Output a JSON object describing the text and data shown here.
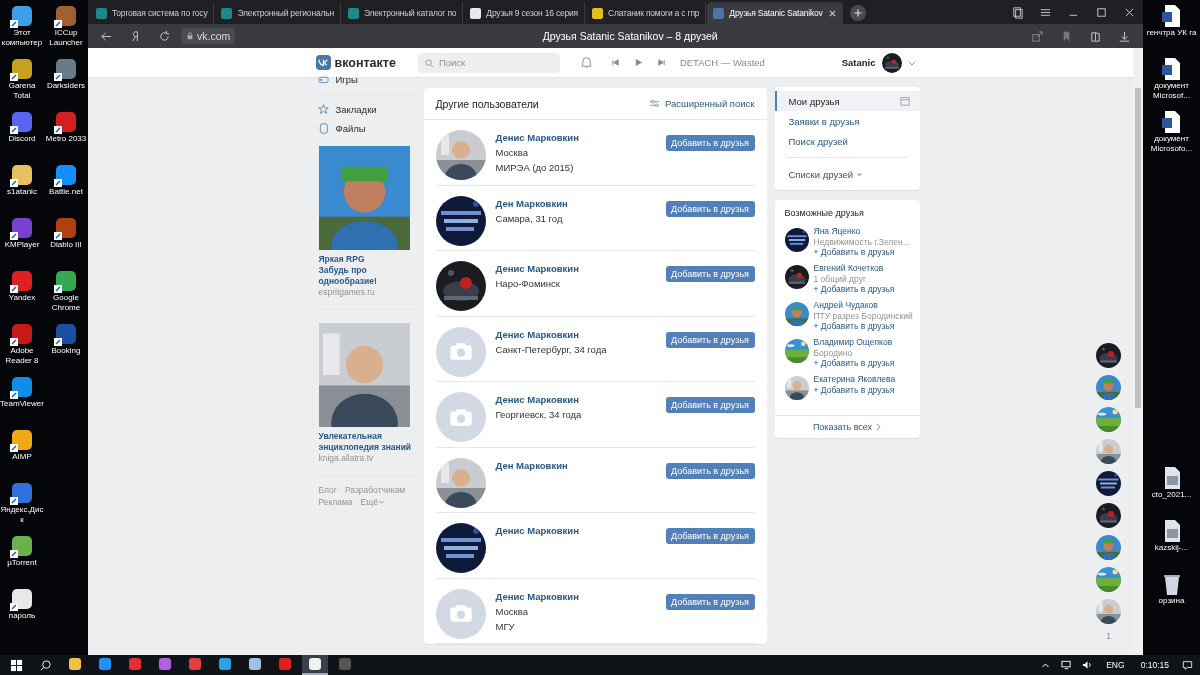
{
  "desktop_left": {
    "columns": [
      [
        {
          "label": "Этот компьютер",
          "color": "#3aa0e8"
        },
        {
          "label": "Garena Total",
          "color": "#c8a020"
        },
        {
          "label": "Discord",
          "color": "#5865f2"
        },
        {
          "label": "s1atanic",
          "color": "#e8c060"
        },
        {
          "label": "KMPlayer",
          "color": "#7a3fd0"
        },
        {
          "label": "Yandex",
          "color": "#e02020"
        },
        {
          "label": "Adobe Reader 8",
          "color": "#c81818"
        },
        {
          "label": "TeamViewer",
          "color": "#0e8ee9"
        },
        {
          "label": "AIMP",
          "color": "#f0a818"
        },
        {
          "label": "Яндекс.Диск",
          "color": "#3070e0"
        },
        {
          "label": "µTorrent",
          "color": "#6ab04c"
        },
        {
          "label": "пароль",
          "color": "#e8e8e8"
        }
      ],
      [
        {
          "label": "ICCup Launcher",
          "color": "#a06030"
        },
        {
          "label": "Darksiders",
          "color": "#6a7a8a"
        },
        {
          "label": "Metro 2033",
          "color": "#d02020"
        },
        {
          "label": "Battle.net",
          "color": "#148eff"
        },
        {
          "label": "Diablo III",
          "color": "#b04010"
        },
        {
          "label": "Google Chrome",
          "color": "#34a853"
        },
        {
          "label": "Booking",
          "color": "#1a4fa0"
        }
      ]
    ]
  },
  "browser": {
    "tabs": [
      {
        "title": "Торговая система по госу",
        "color": "#1a8a8a",
        "selected": false
      },
      {
        "title": "Электронный региональн",
        "color": "#1a8a8a",
        "selected": false
      },
      {
        "title": "Электронный каталог по",
        "color": "#1a8a8a",
        "selected": false
      },
      {
        "title": "Друзья 9 сезон 16 серия",
        "color": "#e8e8e8",
        "selected": false
      },
      {
        "title": "Слатаник помоги а с гпр",
        "color": "#e0c020",
        "selected": false
      },
      {
        "title": "Друзья Satanic Satanikov",
        "color": "#4a76a8",
        "selected": true
      }
    ],
    "address": "vk.com",
    "page_title": "Друзья Satanic Satanikov – 8 друзей"
  },
  "vk_header": {
    "logo": "вконтакте",
    "search_placeholder": "Поиск",
    "track": "DETACH — Wasted",
    "user": "Satanic"
  },
  "left_menu": {
    "items": [
      "Игры",
      "Закладки",
      "Файлы"
    ],
    "ads": [
      {
        "title": "Яркая RPG",
        "text": "Забудь про однообразие!",
        "domain": "espritgames.ru"
      },
      {
        "title": "Увлекательная энциклопедия знаний",
        "domain": "kniga.allatra.tv"
      }
    ],
    "footer": [
      "Блог",
      "Разработчикам",
      "Реклама",
      "Ещё"
    ]
  },
  "people": {
    "title": "Другие пользователи",
    "advanced_search": "Расширенный поиск",
    "rows": [
      {
        "name": "Денис Марковкин",
        "details": [
          "Москва",
          "МИРЭА (до 2015)"
        ],
        "kind": "picture",
        "button": "Добавить в друзья"
      },
      {
        "name": "Ден Марковкин",
        "details": [
          "Самара, 31 год"
        ],
        "kind": "picture",
        "button": "Добавить в друзья"
      },
      {
        "name": "Денис Марковкин",
        "details": [
          "Наро-Фоминск"
        ],
        "kind": "picture",
        "button": "Добавить в друзья"
      },
      {
        "name": "Денис Марковкин",
        "details": [
          "Санкт-Петербург, 34 года"
        ],
        "kind": "placeholder",
        "button": "Добавить в друзья"
      },
      {
        "name": "Денис Марковкин",
        "details": [
          "Георгиевск, 34 года"
        ],
        "kind": "placeholder",
        "button": "Добавить в друзья"
      },
      {
        "name": "Ден Марковкин",
        "details": [],
        "kind": "picture",
        "button": "Добавить в друзья"
      },
      {
        "name": "Денис Марковкин",
        "details": [],
        "kind": "picture",
        "button": "Добавить в друзья"
      },
      {
        "name": "Денис Марковкин",
        "details": [
          "Москва",
          "МГУ"
        ],
        "kind": "placeholder",
        "button": "Добавить в друзья"
      }
    ]
  },
  "friends_menu": {
    "items": [
      {
        "label": "Мои друзья",
        "selected": true
      },
      {
        "label": "Заявки в друзья",
        "selected": false
      },
      {
        "label": "Поиск друзей",
        "selected": false
      }
    ],
    "lists": "Списки друзей"
  },
  "possible_friends": {
    "title": "Возможные друзья",
    "show_all": "Показать всех",
    "items": [
      {
        "name": "Яна Яценко",
        "info": "Недвижимость г.Зелен...",
        "add": "+ Добавить в друзья"
      },
      {
        "name": "Евгений Кочетков",
        "info": "1 общий друг",
        "add": "+ Добавить в друзья"
      },
      {
        "name": "Андрей Чудаков",
        "info": "ПТУ разрез Бородинский",
        "add": "+ Добавить в друзья"
      },
      {
        "name": "Владимир Ощепков",
        "info": "Бородино",
        "add": "+ Добавить в друзья"
      },
      {
        "name": "Екатерина Яковлева",
        "add": "+ Добавить в друзья"
      }
    ]
  },
  "chats": {
    "count": "1"
  },
  "desktop_right": {
    "top": [
      "генчтра УК га",
      "документ Microsof...",
      "документ Microsofo..."
    ],
    "bottom": [
      "cto_2021...",
      "kazskij-...",
      "орзина"
    ]
  },
  "taskbar": {
    "apps": [
      {
        "color": "#f0c040",
        "selected": false
      },
      {
        "color": "#1e90ff",
        "selected": false
      },
      {
        "color": "#e03030",
        "selected": false
      },
      {
        "color": "#b060e0",
        "selected": false
      },
      {
        "color": "#e04040",
        "selected": false
      },
      {
        "color": "#2aa3e0",
        "selected": false
      },
      {
        "color": "#a0c0e0",
        "selected": false
      },
      {
        "color": "#e02020",
        "selected": false
      },
      {
        "color": "#f0f0f0",
        "selected": true
      },
      {
        "color": "#555555",
        "selected": false
      }
    ],
    "language": "ENG",
    "time": "0:10:15"
  }
}
